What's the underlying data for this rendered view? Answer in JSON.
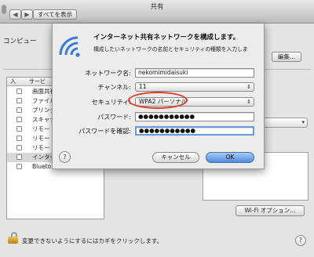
{
  "window": {
    "title": "共有",
    "show_all_label": "すべてを表示",
    "back_label": "◀",
    "forward_label": "▶"
  },
  "background": {
    "computer_name_label": "コンピュー",
    "hint_text": "コ\nばれます。",
    "edit_label": "編集...",
    "service_list": {
      "header_on": "入",
      "header_service": "サービ",
      "items": [
        "画面共有",
        "ファイル",
        "プリンタ",
        "スキャナ",
        "リモート",
        "リモート",
        "リモート",
        "インター",
        "Blueto"
      ]
    },
    "right_note": "…、ピュータのスリー",
    "wifi_options_label": "Wi-Fi オプション...",
    "lock_text": "変更できないようにするにはカギをクリックします。",
    "help_label": "?"
  },
  "sheet": {
    "title": "インターネット共有ネットワークを構成します。",
    "description": "構成したいネットワークの名前とセキュリティの種類を入力しま",
    "fields": {
      "network_name_label": "ネットワーク名:",
      "network_name_value": "nekomimidaisuki",
      "channel_label": "チャンネル:",
      "channel_value": "11",
      "security_label": "セキュリティ:",
      "security_value": "WPA2 パーソナル",
      "password_label": "パスワード:",
      "password_value": "●●●●●●●●●●●",
      "confirm_label": "パスワードを確認:",
      "confirm_value": "●●●●●●●●●●●"
    },
    "help_label": "?",
    "cancel_label": "キャンセル",
    "ok_label": "OK"
  },
  "colors": {
    "accent_blue": "#4d8be0",
    "highlight_red": "#e0391f"
  }
}
